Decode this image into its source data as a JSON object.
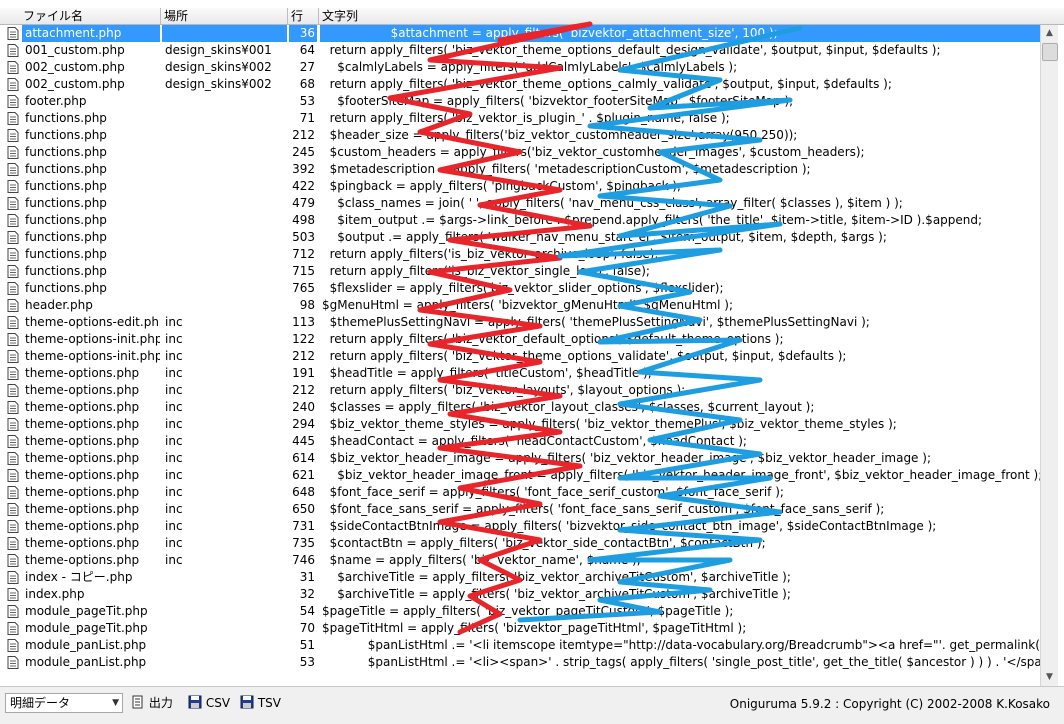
{
  "header": {
    "file": "ファイル名",
    "dir": "場所",
    "line": "行",
    "text": "文字列"
  },
  "rows": [
    {
      "file": "attachment.php",
      "dir": "",
      "line": "36",
      "text": "                  $attachment = apply_filters( 'bizvektor_attachment_size', 100 );"
    },
    {
      "file": "001_custom.php",
      "dir": "design_skins¥001",
      "line": "64",
      "text": "  return apply_filters( 'biz_vektor_theme_options_default_design_validate', $output, $input, $defaults );"
    },
    {
      "file": "002_custom.php",
      "dir": "design_skins¥002",
      "line": "27",
      "text": "    $calmlyLabels = apply_filters( 'addCalmlyLabels', $calmlyLabels );"
    },
    {
      "file": "002_custom.php",
      "dir": "design_skins¥002",
      "line": "68",
      "text": "  return apply_filters( 'biz_vektor_theme_options_calmly_validate', $output, $input, $defaults );"
    },
    {
      "file": "footer.php",
      "dir": "",
      "line": "53",
      "text": "    $footerSiteMap = apply_filters( 'bizvektor_footerSiteMap', $footerSiteMap );"
    },
    {
      "file": "functions.php",
      "dir": "",
      "line": "71",
      "text": "  return apply_filters( 'biz_vektor_is_plugin_' . $plugin_name, false );"
    },
    {
      "file": "functions.php",
      "dir": "",
      "line": "212",
      "text": "  $header_size = apply_filters('biz_vektor_customheader_size',array(950,250));"
    },
    {
      "file": "functions.php",
      "dir": "",
      "line": "245",
      "text": "  $custom_headers = apply_filters('biz_vektor_customheader_images', $custom_headers);"
    },
    {
      "file": "functions.php",
      "dir": "",
      "line": "392",
      "text": "  $metadescription = apply_filters( 'metadescriptionCustom', $metadescription );"
    },
    {
      "file": "functions.php",
      "dir": "",
      "line": "422",
      "text": "  $pingback = apply_filters( 'pingbackCustom', $pingback );"
    },
    {
      "file": "functions.php",
      "dir": "",
      "line": "479",
      "text": "    $class_names = join( ' ', apply_filters( 'nav_menu_css_class', array_filter( $classes ), $item ) );"
    },
    {
      "file": "functions.php",
      "dir": "",
      "line": "498",
      "text": "    $item_output .= $args->link_before . $prepend.apply_filters( 'the_title', $item->title, $item->ID ).$append;"
    },
    {
      "file": "functions.php",
      "dir": "",
      "line": "503",
      "text": "    $output .= apply_filters( 'walker_nav_menu_start_el', $item_output, $item, $depth, $args );"
    },
    {
      "file": "functions.php",
      "dir": "",
      "line": "712",
      "text": "  return apply_filters('is_biz_vektor_archive_loop', false);"
    },
    {
      "file": "functions.php",
      "dir": "",
      "line": "715",
      "text": "  return apply_filters('is_biz_vektor_single_loop', false);"
    },
    {
      "file": "functions.php",
      "dir": "",
      "line": "765",
      "text": "  $flexslider = apply_filters('biz_vektor_slider_options', $flexslider);"
    },
    {
      "file": "header.php",
      "dir": "",
      "line": "98",
      "text": "$gMenuHtml = apply_filters( 'bizvektor_gMenuHtml', $gMenuHtml );"
    },
    {
      "file": "theme-options-edit.php",
      "dir": "inc",
      "line": "113",
      "text": "  $themePlusSettingNavi = apply_filters( 'themePlusSettingNavi', $themePlusSettingNavi );"
    },
    {
      "file": "theme-options-init.php",
      "dir": "inc",
      "line": "122",
      "text": "  return apply_filters( 'biz_vektor_default_options', $default_theme_options );"
    },
    {
      "file": "theme-options-init.php",
      "dir": "inc",
      "line": "212",
      "text": "  return apply_filters( 'biz_vektor_theme_options_validate', $output, $input, $defaults );"
    },
    {
      "file": "theme-options.php",
      "dir": "inc",
      "line": "191",
      "text": "  $headTitle = apply_filters( 'titleCustom', $headTitle );"
    },
    {
      "file": "theme-options.php",
      "dir": "inc",
      "line": "212",
      "text": "  return apply_filters( 'biz_vektor_layouts', $layout_options );"
    },
    {
      "file": "theme-options.php",
      "dir": "inc",
      "line": "240",
      "text": "  $classes = apply_filters( 'biz_vektor_layout_classes', $classes, $current_layout );"
    },
    {
      "file": "theme-options.php",
      "dir": "inc",
      "line": "294",
      "text": "  $biz_vektor_theme_styles = apply_filters( 'biz_vektor_themePlus', $biz_vektor_theme_styles );"
    },
    {
      "file": "theme-options.php",
      "dir": "inc",
      "line": "445",
      "text": "  $headContact = apply_filters( 'headContactCustom', $headContact );"
    },
    {
      "file": "theme-options.php",
      "dir": "inc",
      "line": "614",
      "text": "  $biz_vektor_header_image = apply_filters( 'biz_vektor_header_image', $biz_vektor_header_image );"
    },
    {
      "file": "theme-options.php",
      "dir": "inc",
      "line": "621",
      "text": "    $biz_vektor_header_image_front = apply_filters( 'biz_vektor_header_image_front', $biz_vektor_header_image_front );"
    },
    {
      "file": "theme-options.php",
      "dir": "inc",
      "line": "648",
      "text": "  $font_face_serif = apply_filters( 'font_face_serif_custom', $font_face_serif );"
    },
    {
      "file": "theme-options.php",
      "dir": "inc",
      "line": "650",
      "text": "  $font_face_sans_serif = apply_filters( 'font_face_sans_serif_custom', $font_face_sans_serif );"
    },
    {
      "file": "theme-options.php",
      "dir": "inc",
      "line": "731",
      "text": "  $sideContactBtnImage = apply_filters( 'bizvektor_side_contact_btn_image', $sideContactBtnImage );"
    },
    {
      "file": "theme-options.php",
      "dir": "inc",
      "line": "735",
      "text": "  $contactBtn = apply_filters( 'biz_vektor_side_contactBtn', $contactBtn );"
    },
    {
      "file": "theme-options.php",
      "dir": "inc",
      "line": "746",
      "text": "  $name = apply_filters( 'biz_vektor_name', $name );"
    },
    {
      "file": "index - コピー.php",
      "dir": "",
      "line": "31",
      "text": "    $archiveTitle = apply_filters( 'biz_vektor_archiveTitCustom', $archiveTitle );"
    },
    {
      "file": "index.php",
      "dir": "",
      "line": "32",
      "text": "    $archiveTitle = apply_filters( 'biz_vektor_archiveTitCustom', $archiveTitle );"
    },
    {
      "file": "module_pageTit.php",
      "dir": "",
      "line": "54",
      "text": "$pageTitle = apply_filters( 'biz_vektor_pageTitCustom', $pageTitle );"
    },
    {
      "file": "module_pageTit.php",
      "dir": "",
      "line": "70",
      "text": "$pageTitHtml = apply_filters( 'bizvektor_pageTitHtml', $pageTitHtml );"
    },
    {
      "file": "module_panList.php",
      "dir": "",
      "line": "51",
      "text": "            $panListHtml .= '<li itemscope itemtype=\"http://data-vocabulary.org/Breadcrumb\"><a href=\"'. get_permalink($ancest"
    },
    {
      "file": "module_panList.php",
      "dir": "",
      "line": "53",
      "text": "            $panListHtml .= '<li><span>' . strip_tags( apply_filters( 'single_post_title', get_the_title( $ancestor ) ) ) . '</span></"
    }
  ],
  "statusbar": {
    "select_value": "明細データ",
    "output_label": "出力",
    "csv_label": "CSV",
    "tsv_label": "TSV",
    "copyright": "Oniguruma 5.9.2 : Copyright (C) 2002-2008 K.Kosako"
  },
  "colors": {
    "selection": "#3399ff",
    "red_scribble": "#e8252a",
    "blue_scribble": "#1e9ee0"
  }
}
